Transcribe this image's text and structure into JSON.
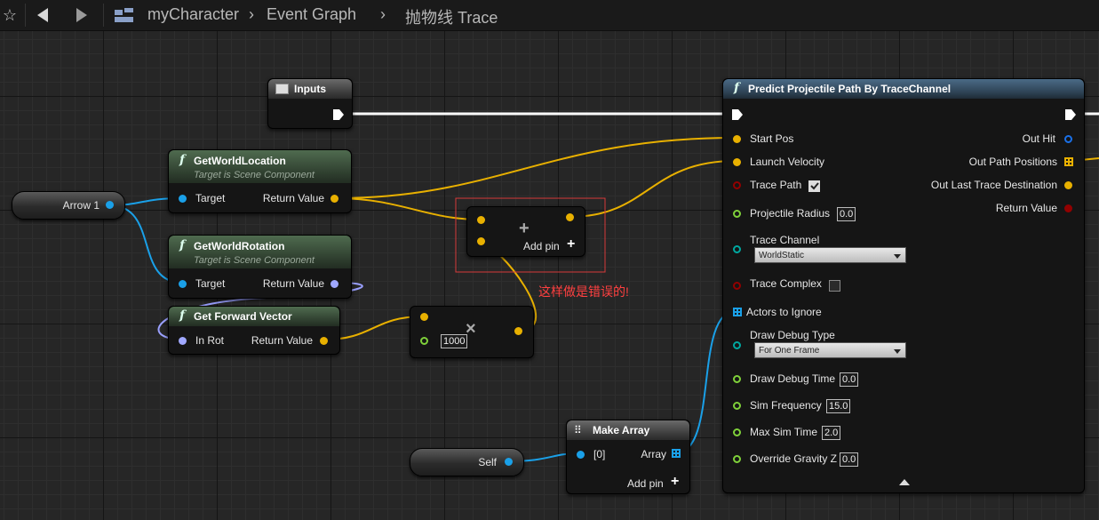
{
  "breadcrumb": {
    "blueprint": "myCharacter",
    "graph": "Event Graph",
    "function": "抛物线 Trace"
  },
  "colors": {
    "exec": "#ffffff",
    "object": "#1aa0e8",
    "vector": "#f0b800",
    "rotator": "#a0a8ff",
    "float": "#7fd13a",
    "bool": "#920000",
    "channel": "#00a8a0",
    "warning": "#ff4040"
  },
  "nodes": {
    "inputs": {
      "title": "Inputs"
    },
    "get_world_location": {
      "title": "GetWorldLocation",
      "subtitle": "Target is Scene Component",
      "in_target": "Target",
      "out_return": "Return Value"
    },
    "get_world_rotation": {
      "title": "GetWorldRotation",
      "subtitle": "Target is Scene Component",
      "in_target": "Target",
      "out_return": "Return Value"
    },
    "get_forward_vector": {
      "title": "Get Forward Vector",
      "in_rot": "In Rot",
      "out_return": "Return Value"
    },
    "arrow": {
      "label": "Arrow 1"
    },
    "self": {
      "label": "Self"
    },
    "add": {
      "add_pin": "Add pin",
      "op": "+"
    },
    "multiply": {
      "value": "1000",
      "op": "×"
    },
    "make_array": {
      "title": "Make Array",
      "in0": "[0]",
      "out": "Array",
      "add_pin": "Add pin"
    },
    "predict": {
      "title": "Predict Projectile Path By TraceChannel",
      "inputs": {
        "start_pos": "Start Pos",
        "launch_velocity": "Launch Velocity",
        "trace_path": "Trace Path",
        "projectile_radius": "Projectile Radius",
        "projectile_radius_val": "0.0",
        "trace_channel": "Trace Channel",
        "trace_channel_val": "WorldStatic",
        "trace_complex": "Trace Complex",
        "actors_to_ignore": "Actors to Ignore",
        "draw_debug_type": "Draw Debug Type",
        "draw_debug_type_val": "For One Frame",
        "draw_debug_time": "Draw Debug Time",
        "draw_debug_time_val": "0.0",
        "sim_frequency": "Sim Frequency",
        "sim_frequency_val": "15.0",
        "max_sim_time": "Max Sim Time",
        "max_sim_time_val": "2.0",
        "override_gravity_z": "Override Gravity Z",
        "override_gravity_z_val": "0.0"
      },
      "outputs": {
        "out_hit": "Out Hit",
        "out_path_positions": "Out Path Positions",
        "out_last_trace_destination": "Out Last Trace Destination",
        "return_value": "Return Value"
      }
    }
  },
  "annotation": {
    "text": "这样做是错误的!"
  }
}
